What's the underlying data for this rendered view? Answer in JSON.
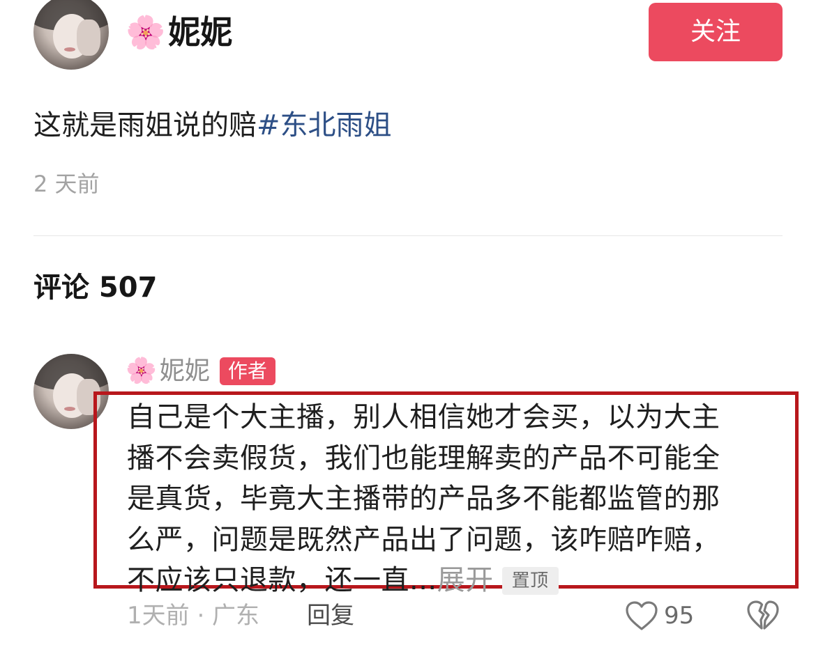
{
  "post": {
    "author_flower": "🌸",
    "author_name": "妮妮",
    "follow_label": "关注",
    "text_main": "这就是雨姐说的赔",
    "hashtag": "#东北雨姐",
    "time": "2 天前"
  },
  "comments": {
    "title": "评论 507"
  },
  "comment": {
    "author_flower": "🌸",
    "author_name": "妮妮",
    "author_badge": "作者",
    "lines": [
      "自己是个大主播，别人相信她才会买，以为大主",
      "播不会卖假货，我们也能理解卖的产品不可能全",
      "是真货，毕竟大主播带的产品多不能都监管的那",
      "么严，问题是既然产品出了问题，该咋赔咋赔，",
      "不应该只退款，还一直..."
    ],
    "expand_label": "展开",
    "pin_label": "置顶",
    "time_location": "1天前 · 广东",
    "reply_label": "回复",
    "like_count": "95"
  },
  "colors": {
    "accent": "#ec4a5f",
    "hashtag": "#2d4f86",
    "highlight_border": "#b8171c"
  },
  "icons": {
    "like": "heart-outline-icon",
    "dislike": "broken-heart-icon"
  }
}
